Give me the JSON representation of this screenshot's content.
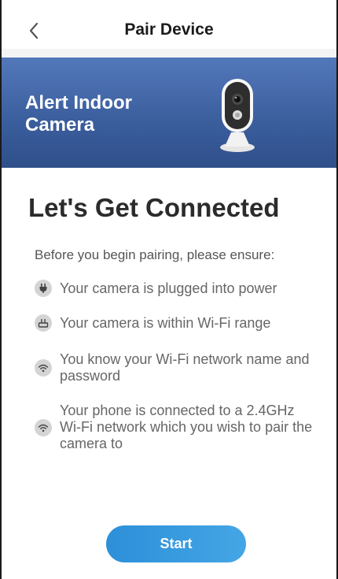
{
  "header": {
    "back_icon": "chevron-left-icon",
    "title": "Pair Device"
  },
  "banner": {
    "device_name": "Alert Indoor Camera",
    "image": "indoor-camera-image",
    "background_color": "#3a5d9c"
  },
  "main": {
    "heading": "Let's Get Connected",
    "subheading": "Before you begin pairing, please ensure:",
    "requirements": [
      {
        "icon": "power-plug-icon",
        "text": "Your camera is plugged into power"
      },
      {
        "icon": "router-icon",
        "text": "Your camera is within Wi-Fi range"
      },
      {
        "icon": "wifi-icon",
        "text": "You know your Wi-Fi network name and password"
      },
      {
        "icon": "wifi-icon",
        "text": "Your phone is connected to a 2.4GHz Wi-Fi network which you wish to pair the camera to"
      }
    ]
  },
  "actions": {
    "start_label": "Start",
    "accent_color": "#2c8fd9"
  }
}
